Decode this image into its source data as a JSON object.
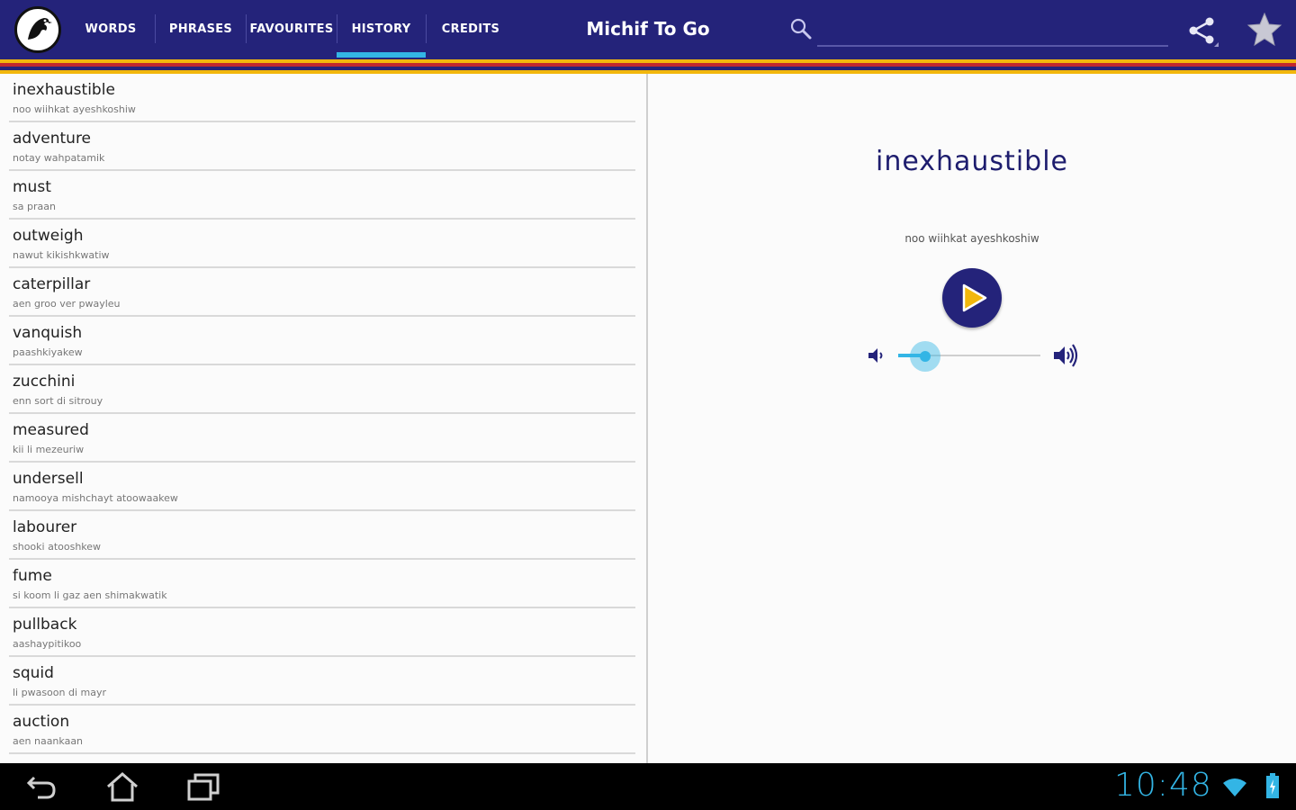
{
  "header": {
    "tabs": [
      {
        "label": "WORDS",
        "active": false
      },
      {
        "label": "PHRASES",
        "active": false
      },
      {
        "label": "FAVOURITES",
        "active": false
      },
      {
        "label": "HISTORY",
        "active": true
      },
      {
        "label": "CREDITS",
        "active": false
      }
    ],
    "app_title": "Michif To Go",
    "search": {
      "value": "",
      "placeholder": ""
    },
    "colors": {
      "bar": "#24237a",
      "accent": "#33b5e5",
      "stripes": [
        "#f2b70c",
        "#c1272d",
        "#24237a",
        "#f2b70c"
      ]
    },
    "icons": {
      "logo": "eagle-logo-icon",
      "search": "search-icon",
      "share": "share-icon",
      "favourite": "star-icon"
    }
  },
  "history": {
    "items": [
      {
        "word": "inexhaustible",
        "translation": "noo wiihkat ayeshkoshiw"
      },
      {
        "word": "adventure",
        "translation": "notay wahpatamik"
      },
      {
        "word": "must",
        "translation": "sa praan"
      },
      {
        "word": "outweigh",
        "translation": "nawut kikishkwatiw"
      },
      {
        "word": "caterpillar",
        "translation": "aen groo ver pwayleu"
      },
      {
        "word": "vanquish",
        "translation": "paashkiyakew"
      },
      {
        "word": "zucchini",
        "translation": "enn sort di sitrouy"
      },
      {
        "word": "measured",
        "translation": "kii li mezeuriw"
      },
      {
        "word": "undersell",
        "translation": "namooya mishchayt atoowaakew"
      },
      {
        "word": "labourer",
        "translation": "shooki atooshkew"
      },
      {
        "word": "fume",
        "translation": "si koom li gaz aen shimakwatik"
      },
      {
        "word": "pullback",
        "translation": "aashaypitikoo"
      },
      {
        "word": "squid",
        "translation": "li pwasoon di mayr"
      },
      {
        "word": "auction",
        "translation": "aen naankaan"
      }
    ]
  },
  "detail": {
    "word": "inexhaustible",
    "translation": "noo wiihkat ayeshkoshiw",
    "volume_fraction": 0.19,
    "icons": {
      "play": "play-icon",
      "volume_low": "volume-low-icon",
      "volume_high": "volume-high-icon"
    }
  },
  "system_bar": {
    "time": "10:48",
    "icons": [
      "back-icon",
      "home-icon",
      "recent-apps-icon",
      "wifi-icon",
      "battery-icon"
    ]
  }
}
